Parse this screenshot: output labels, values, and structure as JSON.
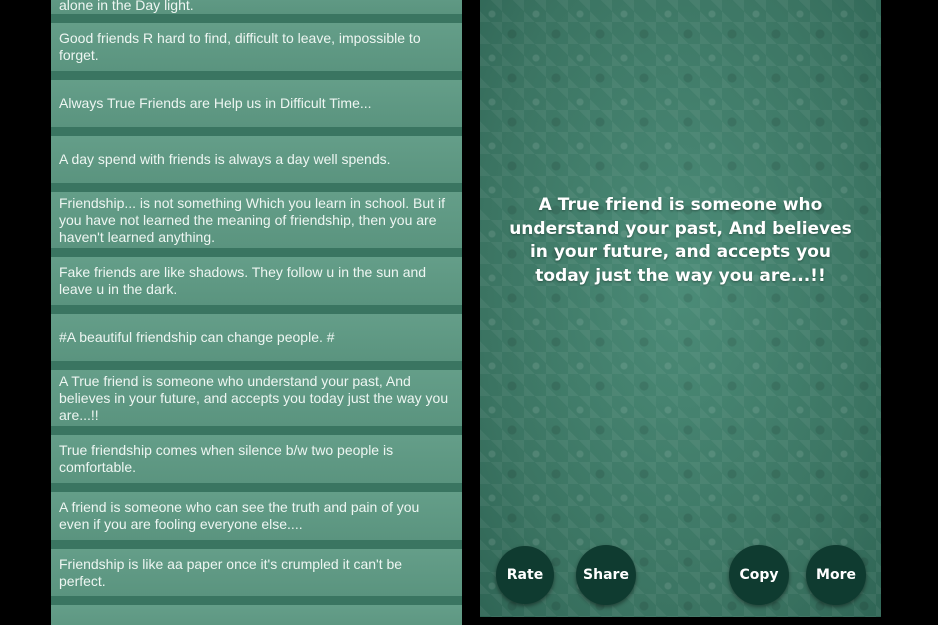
{
  "quotes": [
    "alone in the Day light.",
    "Good friends R hard to find, difficult to leave, impossible to forget.",
    "Always True Friends are Help us in Difficult Time...",
    "A day spend with friends is always a day well spends.",
    "Friendship... is not something Which you learn in school. But if you have not learned the meaning of friendship, then you are haven't learned anything.",
    "Fake friends are like shadows. They follow u in the sun and leave u in the dark.",
    "#A beautiful friendship can change people. #",
    "A True friend is someone who understand your past, And believes in your future, and accepts you today just the way you are...!!",
    "True friendship comes when silence b/w two people is comfortable.",
    "A friend is someone who can see the truth and pain of you even if you are fooling everyone else....",
    "Friendship is like aa paper once it's crumpled it can't be perfect."
  ],
  "detail": {
    "quote": "A True friend is someone who understand your past, And believes in your future, and accepts you today just the way you are...!!",
    "buttons": {
      "rate": "Rate",
      "share": "Share",
      "copy": "Copy",
      "more": "More"
    }
  },
  "colors": {
    "card": "#5e9a84",
    "divider": "#3a7561",
    "fab": "#0f3b30",
    "detail_bg": "#3f7a69"
  }
}
